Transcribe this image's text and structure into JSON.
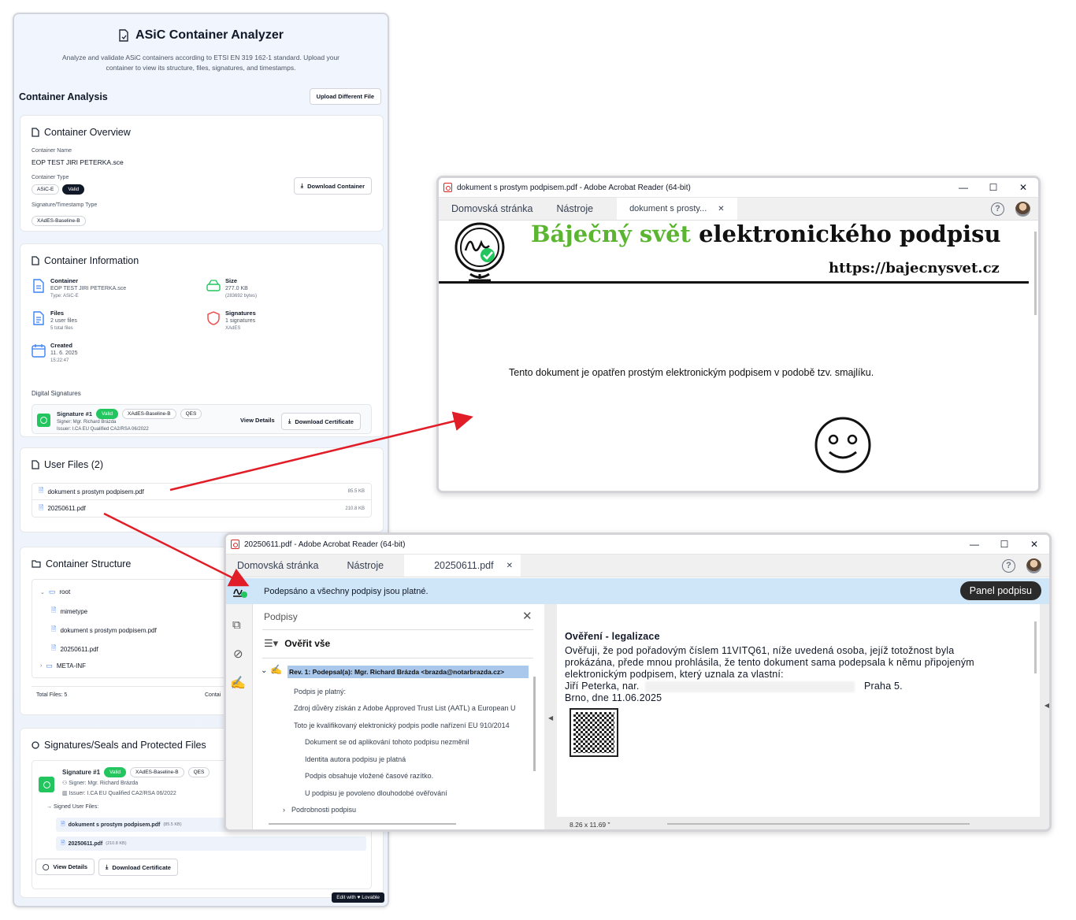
{
  "analyzer": {
    "title": "ASiC Container Analyzer",
    "subtitle": "Analyze and validate ASiC containers according to ETSI EN 319 162-1 standard. Upload your container to view its structure, files, signatures, and timestamps.",
    "section_title": "Container Analysis",
    "upload_button": "Upload Different File",
    "overview": {
      "title": "Container Overview",
      "name_label": "Container Name",
      "name_value": "EOP TEST JIRI PETERKA.sce",
      "type_label": "Container Type",
      "type_value": "ASiC-E",
      "valid_badge": "Valid",
      "sigtype_label": "Signature/Timestamp Type",
      "sigtype_value": "XAdES-Baseline-B",
      "download_button": "Download Container"
    },
    "information": {
      "title": "Container Information",
      "items": [
        {
          "title": "Container",
          "line1": "EOP TEST JIRI PETERKA.sce",
          "line2": "Type: ASiC-E"
        },
        {
          "title": "Size",
          "line1": "277.0 KB",
          "line2": "(283692 bytes)"
        },
        {
          "title": "Files",
          "line1": "2 user files",
          "line2": "5 total files"
        },
        {
          "title": "Signatures",
          "line1": "1 signatures",
          "line2": "XAdES"
        },
        {
          "title": "Created",
          "line1": "11. 6. 2025",
          "line2": "15:22:47"
        }
      ],
      "digital_signatures_label": "Digital Signatures",
      "signature": {
        "name": "Signature #1",
        "valid": "Valid",
        "profile": "XAdES-Baseline-B",
        "level": "QES",
        "signer": "Signer: Mgr. Richard Brázda",
        "issuer": "Issuer: I.CA EU Qualified CA2/RSA 06/2022",
        "view_button": "View Details",
        "download_button": "Download Certificate"
      }
    },
    "user_files": {
      "title": "User Files (2)",
      "files": [
        {
          "name": "dokument s prostym podpisem.pdf",
          "size": "85.5 KB"
        },
        {
          "name": "20250611.pdf",
          "size": "210.8 KB"
        }
      ]
    },
    "structure": {
      "title": "Container Structure",
      "root": "root",
      "items": [
        "mimetype",
        "dokument s prostym podpisem.pdf",
        "20250611.pdf",
        "META-INF"
      ],
      "total_files": "Total Files: 5",
      "truncated": "Contai"
    },
    "protected": {
      "title": "Signatures/Seals and Protected Files",
      "signature": {
        "name": "Signature #1",
        "valid": "Valid",
        "profile": "XAdES-Baseline-B",
        "level": "QES",
        "signer": "Signer: Mgr. Richard Brázda",
        "issuer": "Issuer: I.CA EU Qualified CA2/RSA 06/2022"
      },
      "signed_label": "Signed User Files:",
      "files": [
        {
          "name": "dokument s prostym podpisem.pdf",
          "size": "(85.5 KB)"
        },
        {
          "name": "20250611.pdf",
          "size": "(210.8 KB)"
        }
      ],
      "view_button": "View Details",
      "download_button": "Download Certificate"
    },
    "lovable": "Edit with ♥ Lovable"
  },
  "win1": {
    "title": "dokument s prostym podpisem.pdf - Adobe Acrobat Reader (64-bit)",
    "tab_home": "Domovská stránka",
    "tab_tools": "Nástroje",
    "tab_doc": "dokument s prosty...",
    "banner_green": "Báječný svět",
    "banner_black": "elektronického podpisu",
    "banner_url": "https://bajecnysvet.cz",
    "body_text": "Tento dokument je opatřen prostým elektronickým podpisem v podobě tzv. smajlíku."
  },
  "win2": {
    "title": "20250611.pdf - Adobe Acrobat Reader (64-bit)",
    "tab_home": "Domovská stránka",
    "tab_tools": "Nástroje",
    "tab_doc": "20250611.pdf",
    "sig_status": "Podepsáno a všechny podpisy jsou platné.",
    "panel_button": "Panel podpisu",
    "panel_title": "Podpisy",
    "verify_all": "Ověřit vše",
    "rev": "Rev. 1: Podepsal(a): Mgr. Richard Brázda <brazda@notarbrazda.cz>",
    "details": [
      "Podpis je platný:",
      "Zdroj důvěry získán z Adobe Approved Trust List (AATL) a European U",
      "Toto je kvalifikovaný elektronický podpis podle nařízení EU 910/2014",
      "Dokument se od aplikování tohoto podpisu nezměnil",
      "Identita autora podpisu je platná",
      "Podpis obsahuje vložené časové razítko.",
      "U podpisu je povoleno dlouhodobé ověřování"
    ],
    "sig_details": "Podrobnosti podpisu",
    "doc_heading": "Ověření - legalizace",
    "doc_lines": [
      "Ověřuji, že pod pořadovým číslem 11VITQ61, níže uvedená osoba, jejíž totožnost byla",
      "prokázána, přede mnou prohlásila, že tento dokument sama podepsala k němu připojeným",
      "elektronickým podpisem, který uznala za vlastní:"
    ],
    "person": "Jiří Peterka, nar.",
    "city": "Praha 5.",
    "date_line": "Brno, dne 11.06.2025",
    "page_size": "8.26 x 11.69 \""
  }
}
